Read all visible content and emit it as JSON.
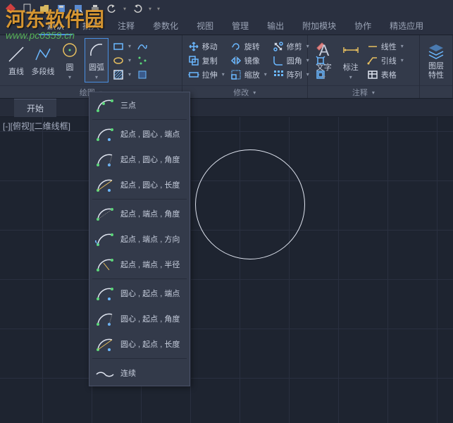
{
  "titlebar": {
    "icons": [
      "menu",
      "new",
      "open",
      "save",
      "saveas",
      "print",
      "undo",
      "redo"
    ]
  },
  "ribbon_tabs": [
    "默认",
    "插入",
    "注释",
    "参数化",
    "视图",
    "管理",
    "输出",
    "附加模块",
    "协作",
    "精选应用"
  ],
  "ribbon_active": 0,
  "panels": {
    "draw": {
      "label": "绘图",
      "line": "直线",
      "polyline": "多段线",
      "circle": "圆",
      "arc": "圆弧"
    },
    "modify": {
      "label": "修改",
      "move": "移动",
      "copy": "复制",
      "stretch": "拉伸",
      "rotate": "旋转",
      "mirror": "镜像",
      "scale": "缩放",
      "trim": "修剪",
      "fillet": "圆角",
      "array": "阵列"
    },
    "annotation": {
      "label": "注释",
      "text": "文字",
      "dim": "标注",
      "linetype": "线性",
      "leader": "引线",
      "table": "表格"
    },
    "layers": {
      "label": "",
      "props": "图层\n特性"
    }
  },
  "doc_tab": "开始",
  "view_label": "[-][俯视][二维线框]",
  "arc_menu": [
    "三点",
    "起点 , 圆心 , 端点",
    "起点 , 圆心 , 角度",
    "起点 , 圆心 , 长度",
    "起点 , 端点 , 角度",
    "起点 , 端点 , 方向",
    "起点 , 端点 , 半径",
    "圆心 , 起点 , 端点",
    "圆心 , 起点 , 角度",
    "圆心 , 起点 , 长度",
    "连续"
  ],
  "watermark": {
    "line1": "河东软件园",
    "line2": "www.pc0359.cn"
  }
}
